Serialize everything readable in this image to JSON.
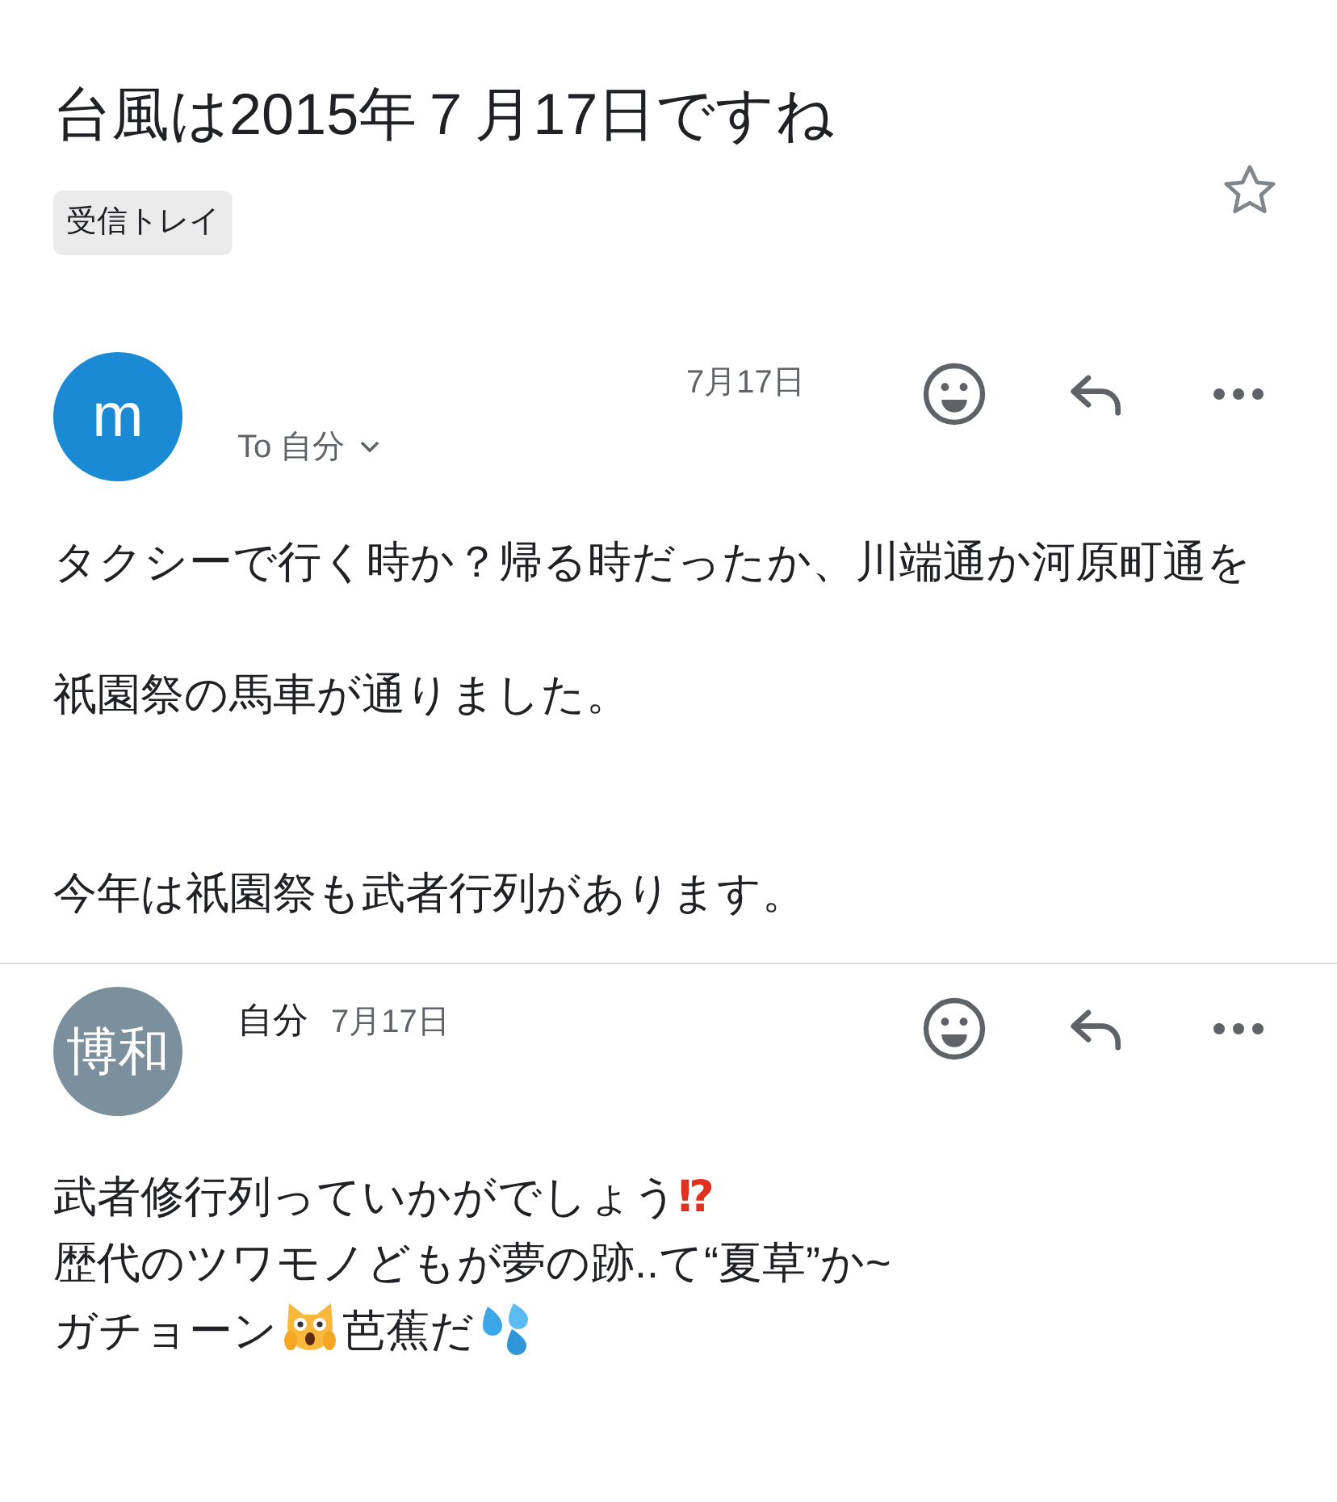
{
  "subject": "台風は2015年７月17日ですね",
  "label": "受信トレイ",
  "starred": false,
  "messages": [
    {
      "avatar": {
        "text": "m",
        "color": "#1a8ad4"
      },
      "date": "7月17日",
      "to": "To 自分",
      "body": [
        [
          {
            "kind": "text",
            "text": "タクシーで行く時か？帰る時だったか、川端通か河原町通を"
          }
        ],
        [
          {
            "kind": "gap"
          }
        ],
        [
          {
            "kind": "text",
            "text": "祇園祭の馬車が通りました。"
          }
        ],
        [
          {
            "kind": "gap"
          }
        ],
        [
          {
            "kind": "gap"
          }
        ],
        [
          {
            "kind": "text",
            "text": "今年は祇園祭も武者行列があります。"
          }
        ]
      ]
    },
    {
      "avatar": {
        "text": "博和",
        "color": "#7b8f9c"
      },
      "sender": "自分",
      "date": "7月17日",
      "body": [
        [
          {
            "kind": "text",
            "text": "武者修行列っていかがでしょう"
          },
          {
            "kind": "mark",
            "text": "⁉"
          }
        ],
        [
          {
            "kind": "text",
            "text": "歴代のツワモノどもが夢の跡..て“夏草”か~"
          }
        ],
        [
          {
            "kind": "text",
            "text": "ガチョーン"
          },
          {
            "kind": "cat"
          },
          {
            "kind": "text",
            "text": "芭蕉だ"
          },
          {
            "kind": "drops"
          }
        ]
      ]
    }
  ]
}
